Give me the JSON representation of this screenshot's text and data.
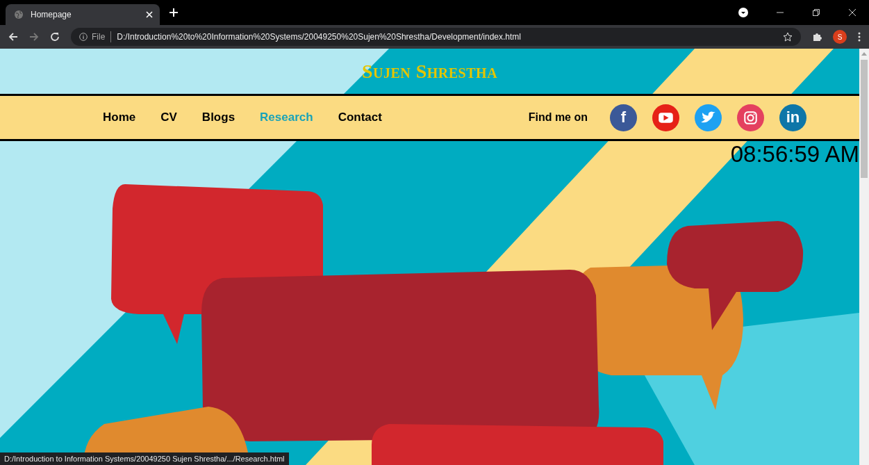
{
  "browser": {
    "tab": {
      "title": "Homepage"
    },
    "address": {
      "scheme": "File",
      "url": "D:/Introduction%20to%20Information%20Systems/20049250%20Sujen%20Shrestha/Development/index.html"
    },
    "profile_initial": "S"
  },
  "page": {
    "site_title": "Sujen Shrestha",
    "nav": [
      {
        "label": "Home",
        "hovered": false
      },
      {
        "label": "CV",
        "hovered": false
      },
      {
        "label": "Blogs",
        "hovered": false
      },
      {
        "label": "Research",
        "hovered": true
      },
      {
        "label": "Contact",
        "hovered": false
      }
    ],
    "find_me_label": "Find me on",
    "social": [
      {
        "kind": "letter",
        "glyph": "f",
        "color": "#3b5998"
      },
      {
        "kind": "play",
        "color": "#e62117"
      },
      {
        "kind": "bird",
        "color": "#1da1f2"
      },
      {
        "kind": "camera",
        "color": "#e4405f"
      },
      {
        "kind": "letter",
        "glyph": "in",
        "color": "#0e76a8"
      }
    ],
    "clock": "08:56:59 AM"
  },
  "status_bar": "D:/Introduction to Information Systems/20049250 Sujen Shrestha/.../Research.html"
}
